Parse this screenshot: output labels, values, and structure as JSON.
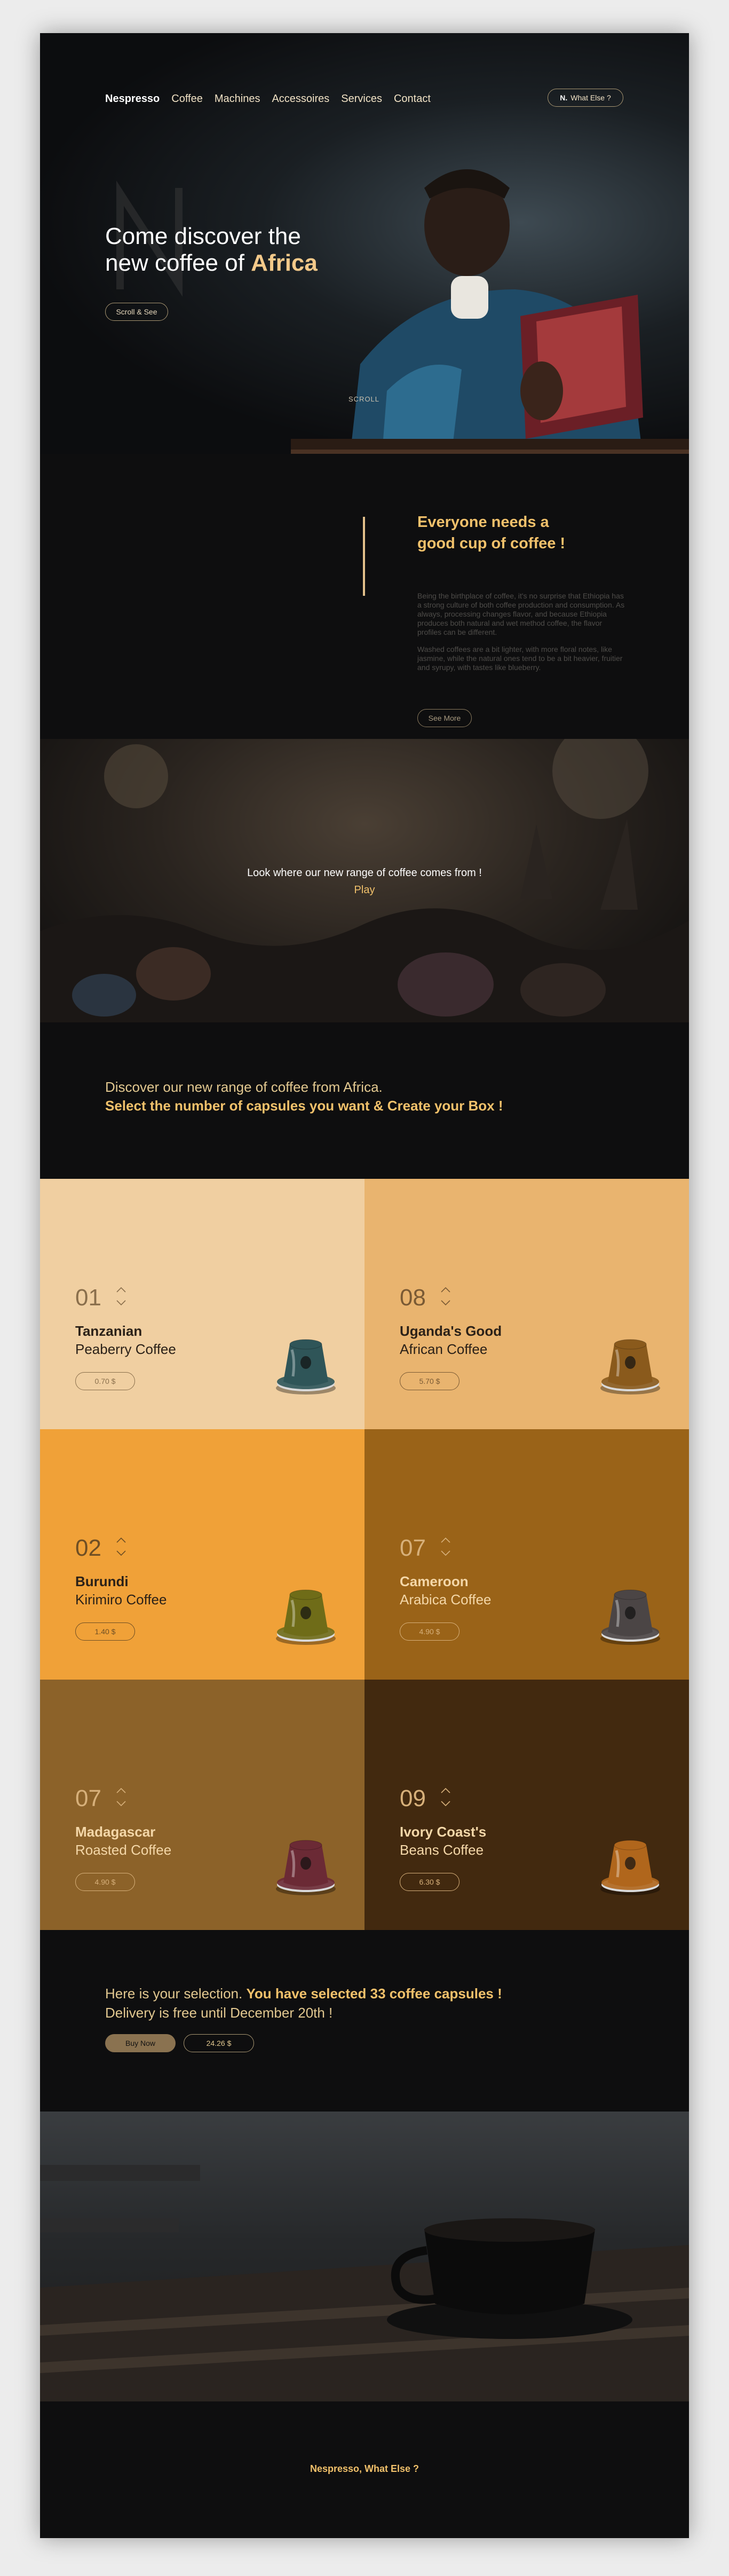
{
  "nav": {
    "brand": "Nespresso",
    "items": [
      "Coffee",
      "Machines",
      "Accessoires",
      "Services",
      "Contact"
    ],
    "cta_mark": "N.",
    "cta": "What Else ?"
  },
  "hero": {
    "title_line1": "Come discover the",
    "title_line2_prefix": "new coffee of ",
    "title_highlight": "Africa",
    "button": "Scroll & See",
    "scroll_label": "SCROLL"
  },
  "intro": {
    "title_line1": "Everyone needs a",
    "title_line2": "good cup of coffee !",
    "paragraph1": "Being the birthplace of coffee, it's no surprise that Ethiopia has a strong culture of both coffee production and consumption. As always, processing changes flavor, and because Ethiopia produces both natural and wet method coffee, the flavor profiles can be different.",
    "paragraph2": "Washed coffees are a bit lighter, with more floral notes, like jasmine, while the natural ones tend to be a bit heavier, fruitier and syrupy, with tastes like blueberry.",
    "button": "See More"
  },
  "video": {
    "text": "Look where our new range of coffee comes from !",
    "play": "Play"
  },
  "discover": {
    "line1": "Discover our new range of coffee from Africa.",
    "line2": "Select the number of capsules you want & Create your Box !"
  },
  "products": [
    {
      "qty": "01",
      "name1": "Tanzanian",
      "name2": "Peaberry Coffee",
      "price": "0.70 $",
      "bg": "#f0cfa1",
      "text": "#2b2118",
      "qtycolor": "#8a6f4c",
      "btn": "#8a6f4c",
      "capsule": "#2f5558"
    },
    {
      "qty": "08",
      "name1": "Uganda's Good",
      "name2": "African Coffee",
      "price": "5.70 $",
      "bg": "#e9b46f",
      "text": "#2b2118",
      "qtycolor": "#7a5a34",
      "btn": "#7a5a34",
      "capsule": "#8a5a1c"
    },
    {
      "qty": "02",
      "name1": "Burundi",
      "name2": "Kirimiro Coffee",
      "price": "1.40 $",
      "bg": "#f0a138",
      "text": "#2b2118",
      "qtycolor": "#6f4f24",
      "btn": "#6f4f24",
      "capsule": "#6f6c18"
    },
    {
      "qty": "07",
      "name1": "Cameroon",
      "name2": "Arabica Coffee",
      "price": "4.90 $",
      "bg": "#9a6318",
      "text": "#f4d7a8",
      "qtycolor": "#d7b07a",
      "btn": "#d7b07a",
      "capsule": "#4b4545"
    },
    {
      "qty": "07",
      "name1": "Madagascar",
      "name2": "Roasted Coffee",
      "price": "4.90 $",
      "bg": "#8c6229",
      "text": "#f4d7a8",
      "qtycolor": "#d7b07a",
      "btn": "#d7b07a",
      "capsule": "#6b2a35"
    },
    {
      "qty": "09",
      "name1": "Ivory Coast's",
      "name2": "Beans Coffee",
      "price": "6.30 $",
      "bg": "#42290f",
      "text": "#f4d7a8",
      "qtycolor": "#d7b07a",
      "btn": "#d7b07a",
      "capsule": "#b0661c"
    }
  ],
  "selection": {
    "line1_prefix": "Here is your selection. ",
    "line1_bold": "You have selected 33 coffee capsules !",
    "line2": "Delivery is free until December 20th !",
    "buy": "Buy Now",
    "total": "24.26 $"
  },
  "footer": {
    "text": "Nespresso, What Else ?"
  },
  "colors": {
    "accent": "#f1c16b",
    "background": "#0e0e0f",
    "button_border": "#a89672"
  }
}
